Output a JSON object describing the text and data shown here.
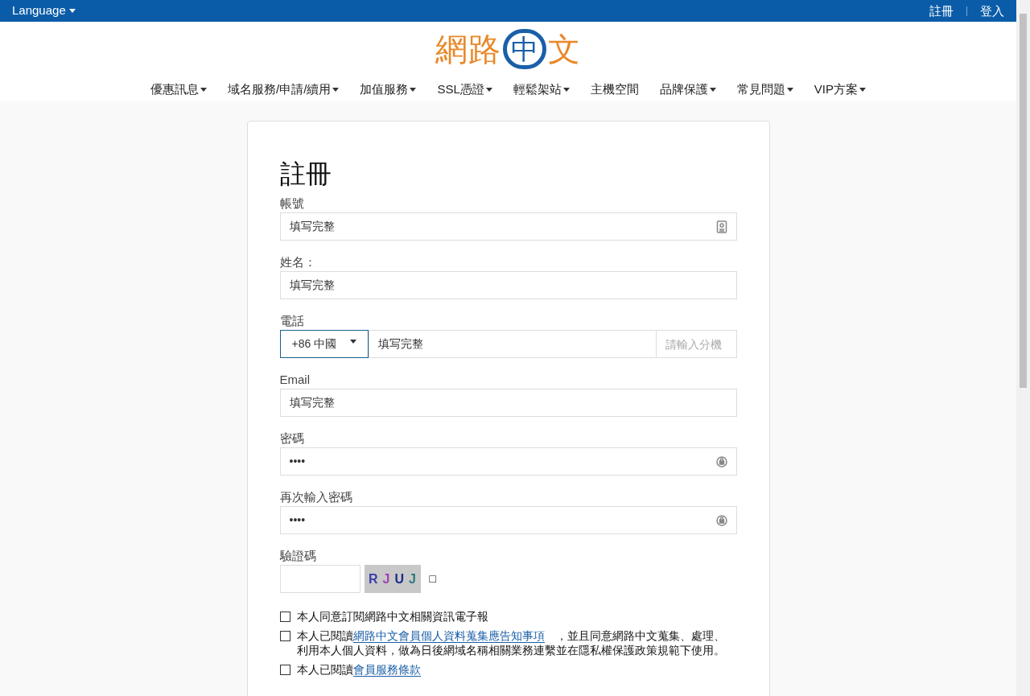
{
  "top_bar": {
    "language": "Language",
    "links": [
      "註冊",
      "登入"
    ]
  },
  "logo": [
    {
      "kind": "plain",
      "text": "網路"
    },
    {
      "kind": "circle",
      "text": "中"
    },
    {
      "kind": "plain",
      "text": "文"
    }
  ],
  "nav": [
    {
      "label": "優惠訊息",
      "dropdown": true
    },
    {
      "label": "域名服務/申請/續用",
      "dropdown": true
    },
    {
      "label": "加值服務",
      "dropdown": true
    },
    {
      "label": "SSL憑證",
      "dropdown": true
    },
    {
      "label": "輕鬆架站",
      "dropdown": true
    },
    {
      "label": "主機空間",
      "dropdown": false
    },
    {
      "label": "品牌保護",
      "dropdown": true
    },
    {
      "label": "常見問題",
      "dropdown": true
    },
    {
      "label": "VIP方案",
      "dropdown": true
    }
  ],
  "form": {
    "title": "註冊",
    "fields": [
      {
        "kind": "account",
        "label": "帳號",
        "value": "填写完整"
      },
      {
        "kind": "text",
        "label": "姓名：",
        "value": "填写完整"
      },
      {
        "kind": "phone",
        "label": "電話",
        "country": "+86 中國",
        "value": "填写完整",
        "placeholder": "請輸入分機"
      },
      {
        "kind": "text",
        "label": "Email",
        "value": "填写完整"
      },
      {
        "kind": "password",
        "label": "密碼",
        "value": "••••"
      },
      {
        "kind": "password",
        "label": "再次輸入密碼",
        "value": "••••"
      },
      {
        "kind": "captcha",
        "label": "驗證碼",
        "captcha": [
          "R",
          "J",
          "U",
          "J"
        ],
        "refresh": "□"
      }
    ],
    "agreements": [
      {
        "checked": false,
        "parts": [
          {
            "kind": "text",
            "text": "本人同意訂閱網路中文相關資訊電子報"
          }
        ]
      },
      {
        "checked": false,
        "parts": [
          {
            "kind": "text",
            "text": "本人已閱讀"
          },
          {
            "kind": "link",
            "text": "網路中文會員個人資料蒐集應告知事項"
          },
          {
            "kind": "text",
            "text": "　，並且同意網路中文蒐集、處理、利用本人個人資料，做為日後網域名稱相關業務連繫並在隱私權保護政策規範下使用。"
          }
        ]
      },
      {
        "checked": false,
        "parts": [
          {
            "kind": "text",
            "text": "本人已閱讀"
          },
          {
            "kind": "link",
            "text": "會員服務條款"
          }
        ]
      }
    ]
  }
}
